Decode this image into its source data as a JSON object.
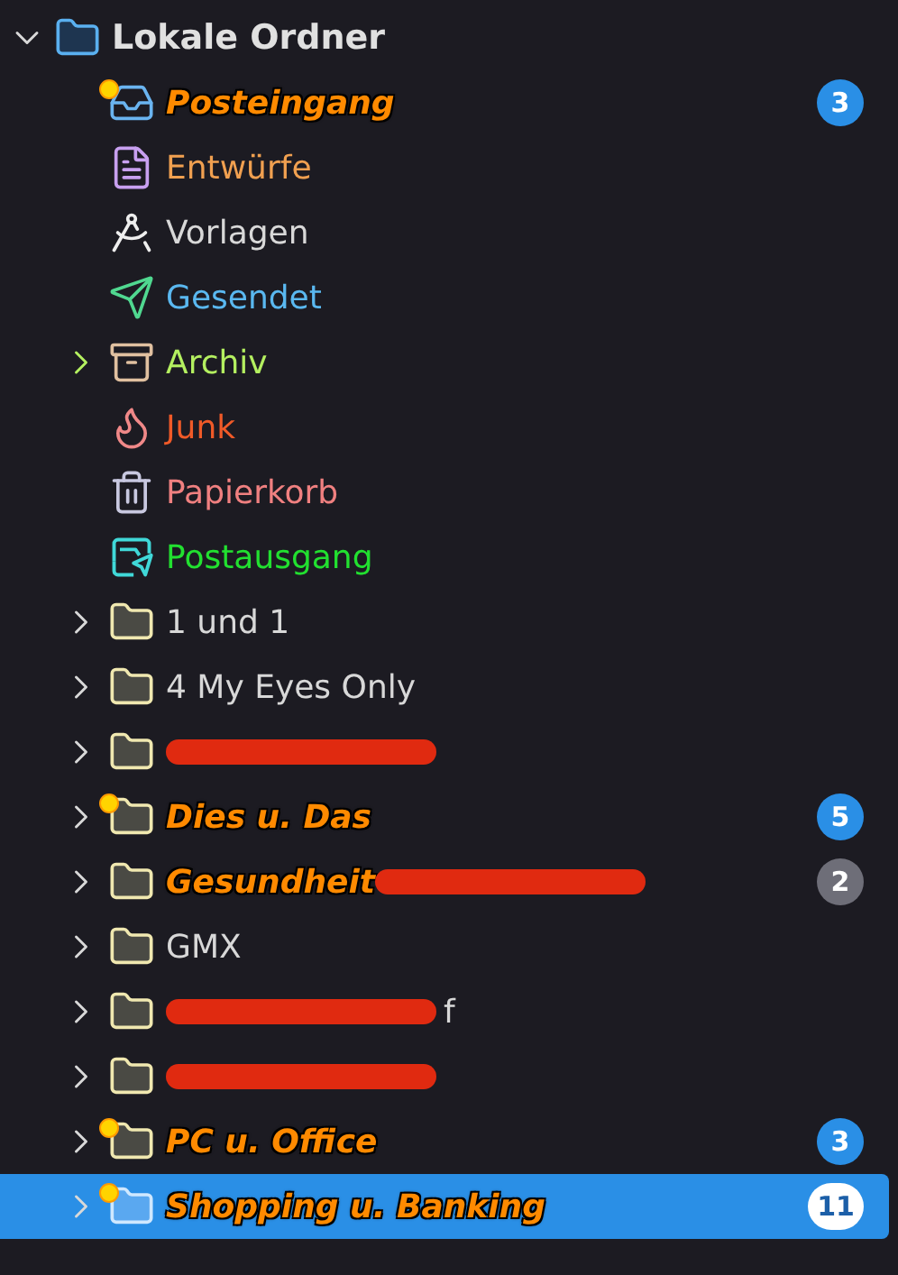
{
  "folders": [
    {
      "name": "Lokale Ordner",
      "kind": "root",
      "expanded": true,
      "selected": false,
      "children": [
        {
          "name": "Posteingang",
          "kind": "inbox",
          "color": "#ff8a00",
          "unread": true,
          "new": true,
          "selected": false,
          "badge": {
            "count": "3",
            "color": "#2a8fe6"
          }
        },
        {
          "name": "Entwürfe",
          "kind": "drafts",
          "color": "#f0a050",
          "unread": false,
          "new": false,
          "selected": false
        },
        {
          "name": "Vorlagen",
          "kind": "templates",
          "color": "#d8d8d8",
          "unread": false,
          "new": false,
          "selected": false
        },
        {
          "name": "Gesendet",
          "kind": "sent",
          "color": "#5ab8f0",
          "unread": false,
          "new": false,
          "selected": false
        },
        {
          "name": "Archiv",
          "kind": "archive",
          "color": "#b4f060",
          "unread": false,
          "new": false,
          "selected": false,
          "expanded": false
        },
        {
          "name": "Junk",
          "kind": "junk",
          "color": "#f05a28",
          "unread": false,
          "new": false,
          "selected": false
        },
        {
          "name": "Papierkorb",
          "kind": "trash",
          "color": "#f08080",
          "unread": false,
          "new": false,
          "selected": false
        },
        {
          "name": "Postausgang",
          "kind": "outbox",
          "color": "#22e030",
          "unread": false,
          "new": false,
          "selected": false
        },
        {
          "name": "1 und 1",
          "kind": "folder",
          "color": "#d8d8d8",
          "unread": false,
          "new": false,
          "selected": false,
          "expanded": false
        },
        {
          "name": "4 My Eyes Only",
          "kind": "folder",
          "color": "#d8d8d8",
          "unread": false,
          "new": false,
          "selected": false,
          "expanded": false
        },
        {
          "kind": "folder",
          "new": false,
          "selected": false,
          "expanded": false,
          "redacted": true
        },
        {
          "name": "Dies u. Das",
          "kind": "folder",
          "color": "#ff8a00",
          "unread": true,
          "new": true,
          "selected": false,
          "expanded": false,
          "badge": {
            "count": "5",
            "color": "#2a8fe6"
          }
        },
        {
          "name": "Gesundheit",
          "kind": "folder",
          "color": "#ff8a00",
          "unread": true,
          "new": false,
          "selected": false,
          "expanded": false,
          "redacted": true,
          "badge": {
            "count": "2",
            "color": "#6e6e78"
          }
        },
        {
          "name": "GMX",
          "kind": "folder",
          "color": "#d8d8d8",
          "unread": false,
          "new": false,
          "selected": false,
          "expanded": false
        },
        {
          "suffix": "f",
          "kind": "folder",
          "color": "#d8d8d8",
          "unread": false,
          "new": false,
          "selected": false,
          "expanded": false,
          "redacted": true
        },
        {
          "kind": "folder",
          "new": false,
          "selected": false,
          "expanded": false,
          "redacted": true
        },
        {
          "name": "PC u. Office",
          "kind": "folder",
          "color": "#ff8a00",
          "unread": true,
          "new": true,
          "selected": false,
          "expanded": false,
          "badge": {
            "count": "3",
            "color": "#2a8fe6"
          }
        },
        {
          "name": "Shopping u. Banking",
          "kind": "folder",
          "color": "#ff8a00",
          "unread": true,
          "new": true,
          "selected": true,
          "expanded": false,
          "badge": {
            "count": "11",
            "color": "#ffffff"
          }
        }
      ]
    }
  ]
}
